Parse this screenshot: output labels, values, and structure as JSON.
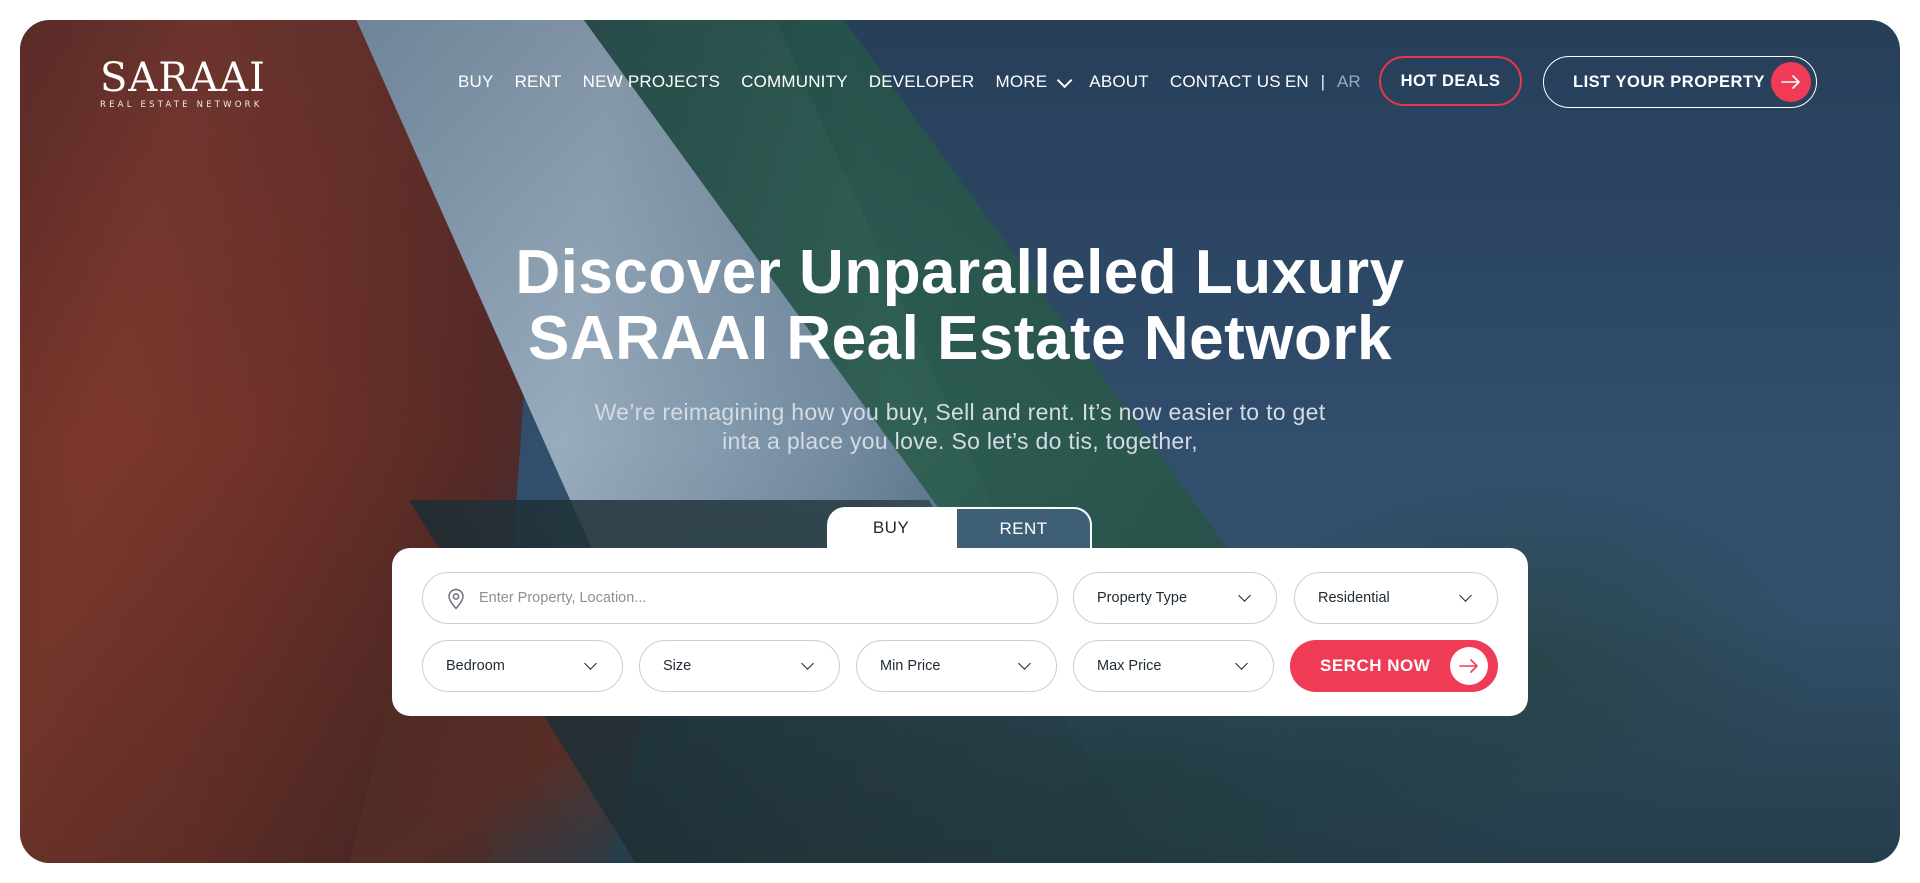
{
  "brand": {
    "name": "SARAAI",
    "tagline": "REAL ESTATE  NETWORK"
  },
  "nav": {
    "items": [
      {
        "label": "BUY"
      },
      {
        "label": "RENT"
      },
      {
        "label": "NEW PROJECTS"
      },
      {
        "label": "COMMUNITY"
      },
      {
        "label": "DEVELOPER"
      },
      {
        "label": "MORE"
      },
      {
        "label": "ABOUT"
      },
      {
        "label": "CONTACT US"
      }
    ],
    "lang_en": "EN",
    "lang_sep": "|",
    "lang_ar": "AR",
    "hot_deals": "HOT DEALS",
    "list_property": "LIST YOUR PROPERTY"
  },
  "hero": {
    "headline_line1": "Discover Unparalleled Luxury",
    "headline_line2": "SARAAI Real Estate Network",
    "subtitle_line1": "We’re reimagining how you buy, Sell and rent. It’s now easier to to get",
    "subtitle_line2": "inta a place you love. So let’s do tis, together,"
  },
  "search": {
    "tabs": [
      {
        "label": "BUY",
        "active": true
      },
      {
        "label": "RENT",
        "active": false
      }
    ],
    "location_placeholder": "Enter Property, Location...",
    "property_type": "Property Type",
    "category": "Residential",
    "bedroom": "Bedroom",
    "size": "Size",
    "min_price": "Min Price",
    "max_price": "Max Price",
    "submit": "SERCH NOW"
  },
  "colors": {
    "accent": "#ef3b56",
    "hot_border": "#e8364f",
    "tab_inactive": "#3f5f77",
    "text_dark": "#1f2a33"
  },
  "icons": {
    "location": "map-pin-icon",
    "dropdown": "chevron-down-icon",
    "arrow": "arrow-right-icon"
  }
}
